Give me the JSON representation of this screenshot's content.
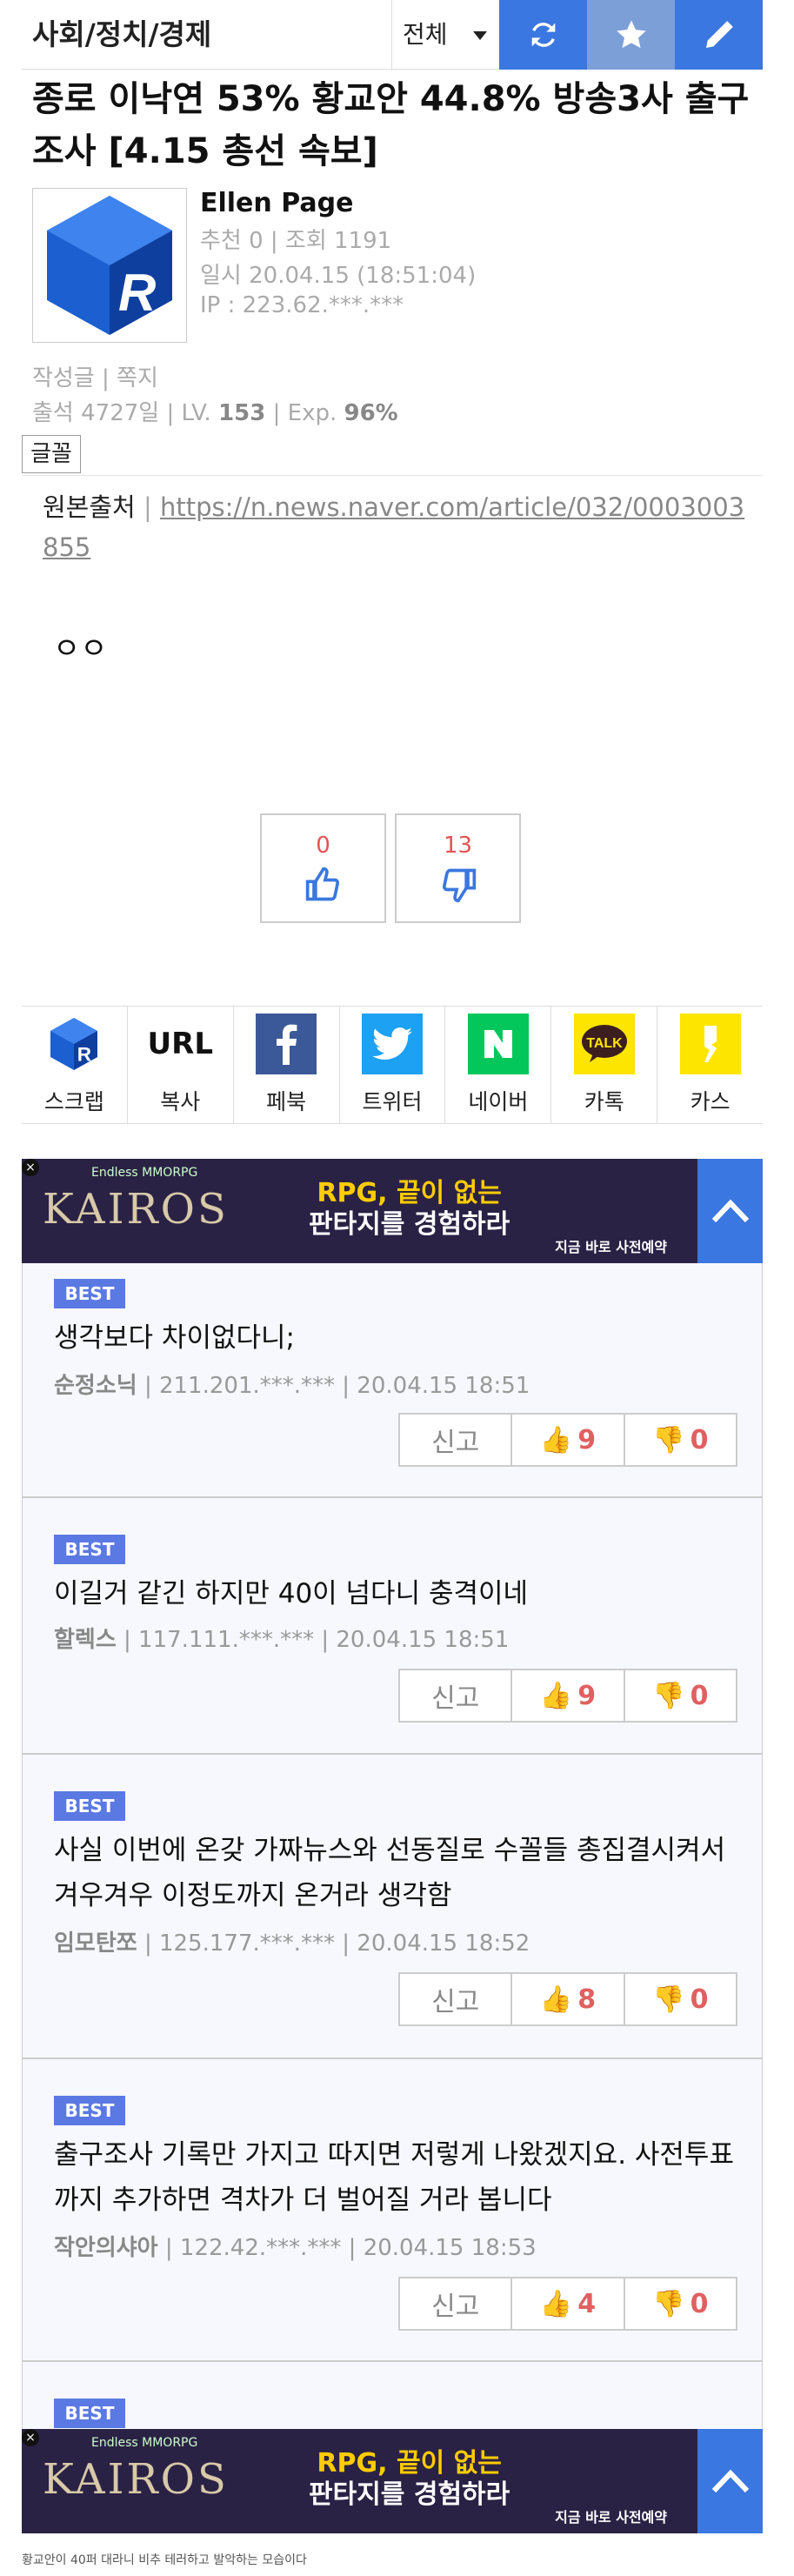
{
  "topbar": {
    "category": "사회/정치/경제",
    "filter": "전체"
  },
  "post": {
    "title": "종로 이낙연 53% 황교안 44.8% 방송3사 출구조사 [4.15 총선 속보]",
    "author": "Ellen Page",
    "recommend_views": "추천 0 | 조회 1191",
    "date": "일시 20.04.15 (18:51:04)",
    "ip": "IP : 223.62.***.***",
    "links": "작성글 | 쪽지",
    "attendance": "출석 4727일 |  LV.",
    "level": "153",
    "exp_label": "| Exp.",
    "exp": "96%",
    "font_button": "글꼴",
    "source_label": "원본출처",
    "source_sep": "|",
    "source_url": "https://n.news.naver.com/article/032/0003003855",
    "body": "ㅇㅇ",
    "upvotes": "0",
    "downvotes": "13"
  },
  "share": [
    {
      "label": "스크랩",
      "icon": "scrap-icon"
    },
    {
      "label": "복사",
      "icon": "url-icon",
      "text": "URL"
    },
    {
      "label": "페북",
      "icon": "facebook-icon",
      "color": "#3b5998"
    },
    {
      "label": "트위터",
      "icon": "twitter-icon",
      "color": "#1da1f2"
    },
    {
      "label": "네이버",
      "icon": "naver-icon",
      "color": "#03c75a"
    },
    {
      "label": "카톡",
      "icon": "kakaotalk-icon",
      "color": "#fee500"
    },
    {
      "label": "카스",
      "icon": "kakaostory-icon",
      "color": "#fee500"
    }
  ],
  "ad": {
    "game": "KAIROS",
    "tag": "Endless MMORPG",
    "slogan_top": "RPG, 끝이 없는",
    "slogan_bottom": "판타지를 경험하라",
    "cta": "지금 바로 사전예약"
  },
  "comments": [
    {
      "badge": "BEST",
      "text": "생각보다 차이없다니;",
      "nick": "순정소닉",
      "meta": " | 211.201.***.*** | 20.04.15 18:51",
      "report": "신고",
      "up": "9",
      "down": "0"
    },
    {
      "badge": "BEST",
      "text": "이길거 같긴 하지만 40이 넘다니 충격이네",
      "nick": "할렉스",
      "meta": " | 117.111.***.*** | 20.04.15 18:51",
      "report": "신고",
      "up": "9",
      "down": "0"
    },
    {
      "badge": "BEST",
      "text": "사실 이번에 온갖 가짜뉴스와 선동질로 수꼴들 총집결시켜서 겨우겨우 이정도까지 온거라 생각함",
      "nick": "임모탄쪼",
      "meta": " | 125.177.***.*** | 20.04.15 18:52",
      "report": "신고",
      "up": "8",
      "down": "0"
    },
    {
      "badge": "BEST",
      "text": "출구조사 기록만 가지고 따지면 저렇게 나왔겠지요. 사전투표까지 추가하면 격차가 더 벌어질 거라 봅니다",
      "nick": "작안의샤아",
      "meta": " | 122.42.***.*** | 20.04.15 18:53",
      "report": "신고",
      "up": "4",
      "down": "0"
    },
    {
      "badge": "BEST"
    }
  ],
  "caption": "황교안이 40퍼 대라니 비추 테러하고 발악하는 모습이다"
}
